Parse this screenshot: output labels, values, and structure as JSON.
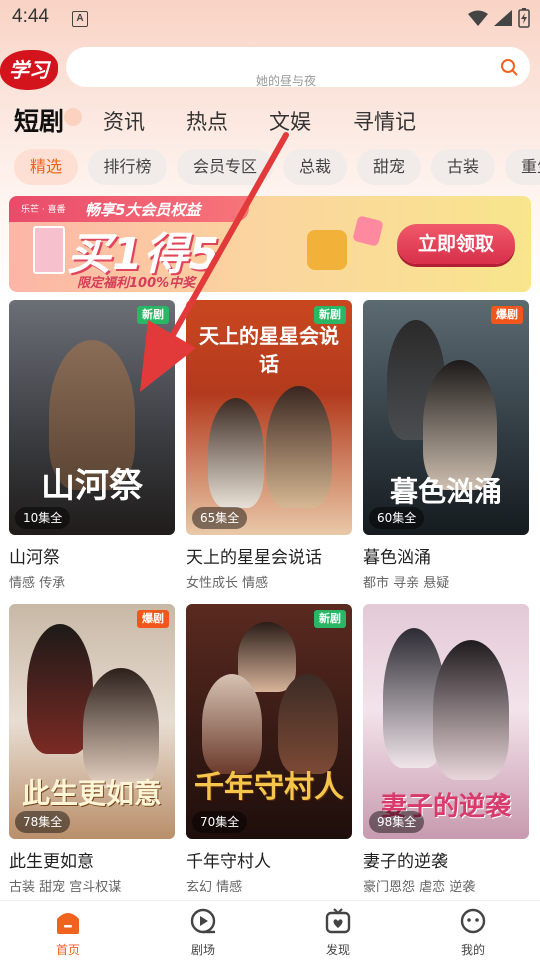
{
  "status_bar": {
    "time": "4:44",
    "notif_icon": "A"
  },
  "logo": {
    "text": "学习"
  },
  "search": {
    "placeholder": "她的昼与夜",
    "icon": "search-icon"
  },
  "categories": [
    {
      "label": "短剧",
      "active": true
    },
    {
      "label": "资讯"
    },
    {
      "label": "热点"
    },
    {
      "label": "文娱"
    },
    {
      "label": "寻情记"
    }
  ],
  "chips": [
    {
      "label": "精选",
      "active": true
    },
    {
      "label": "排行榜"
    },
    {
      "label": "会员专区"
    },
    {
      "label": "总裁"
    },
    {
      "label": "甜宠"
    },
    {
      "label": "古装"
    },
    {
      "label": "重生"
    }
  ],
  "banner": {
    "brand": "乐芒 · 喜番",
    "headline": "畅享5大会员权益",
    "big_text": "买1得5",
    "sub_text": "限定福利100%中奖",
    "cta": "立即领取",
    "colors": {
      "start": "#fcb5a6",
      "end": "#f8e58c",
      "cta": "#e23f57"
    }
  },
  "dramas": [
    {
      "title": "山河祭",
      "tags": "情感 传承",
      "episodes": "10集全",
      "badge": "新剧",
      "badge_type": "new",
      "art": "山河祭"
    },
    {
      "title": "天上的星星会说话",
      "tags": "女性成长 情感",
      "episodes": "65集全",
      "badge": "新剧",
      "badge_type": "new",
      "art": "天上的星星会说话"
    },
    {
      "title": "暮色汹涌",
      "tags": "都市 寻亲 悬疑",
      "episodes": "60集全",
      "badge": "爆剧",
      "badge_type": "hot",
      "art": "暮色汹涌"
    },
    {
      "title": "此生更如意",
      "tags": "古装 甜宠 宫斗权谋",
      "episodes": "78集全",
      "badge": "爆剧",
      "badge_type": "hot",
      "art": "此生更如意"
    },
    {
      "title": "千年守村人",
      "tags": "玄幻 情感",
      "episodes": "70集全",
      "badge": "新剧",
      "badge_type": "new",
      "art": "千年守村人"
    },
    {
      "title": "妻子的逆袭",
      "tags": "豪门恩怨 虐恋 逆袭",
      "episodes": "98集全",
      "badge": "",
      "badge_type": "",
      "art": "妻子的逆袭"
    }
  ],
  "bottom_nav": [
    {
      "label": "首页",
      "icon": "home-icon",
      "active": true
    },
    {
      "label": "剧场",
      "icon": "theater-icon"
    },
    {
      "label": "发现",
      "icon": "discover-icon"
    },
    {
      "label": "我的",
      "icon": "profile-icon"
    }
  ],
  "colors": {
    "accent": "#f0631f",
    "annotation_arrow": "#e23a3a"
  }
}
